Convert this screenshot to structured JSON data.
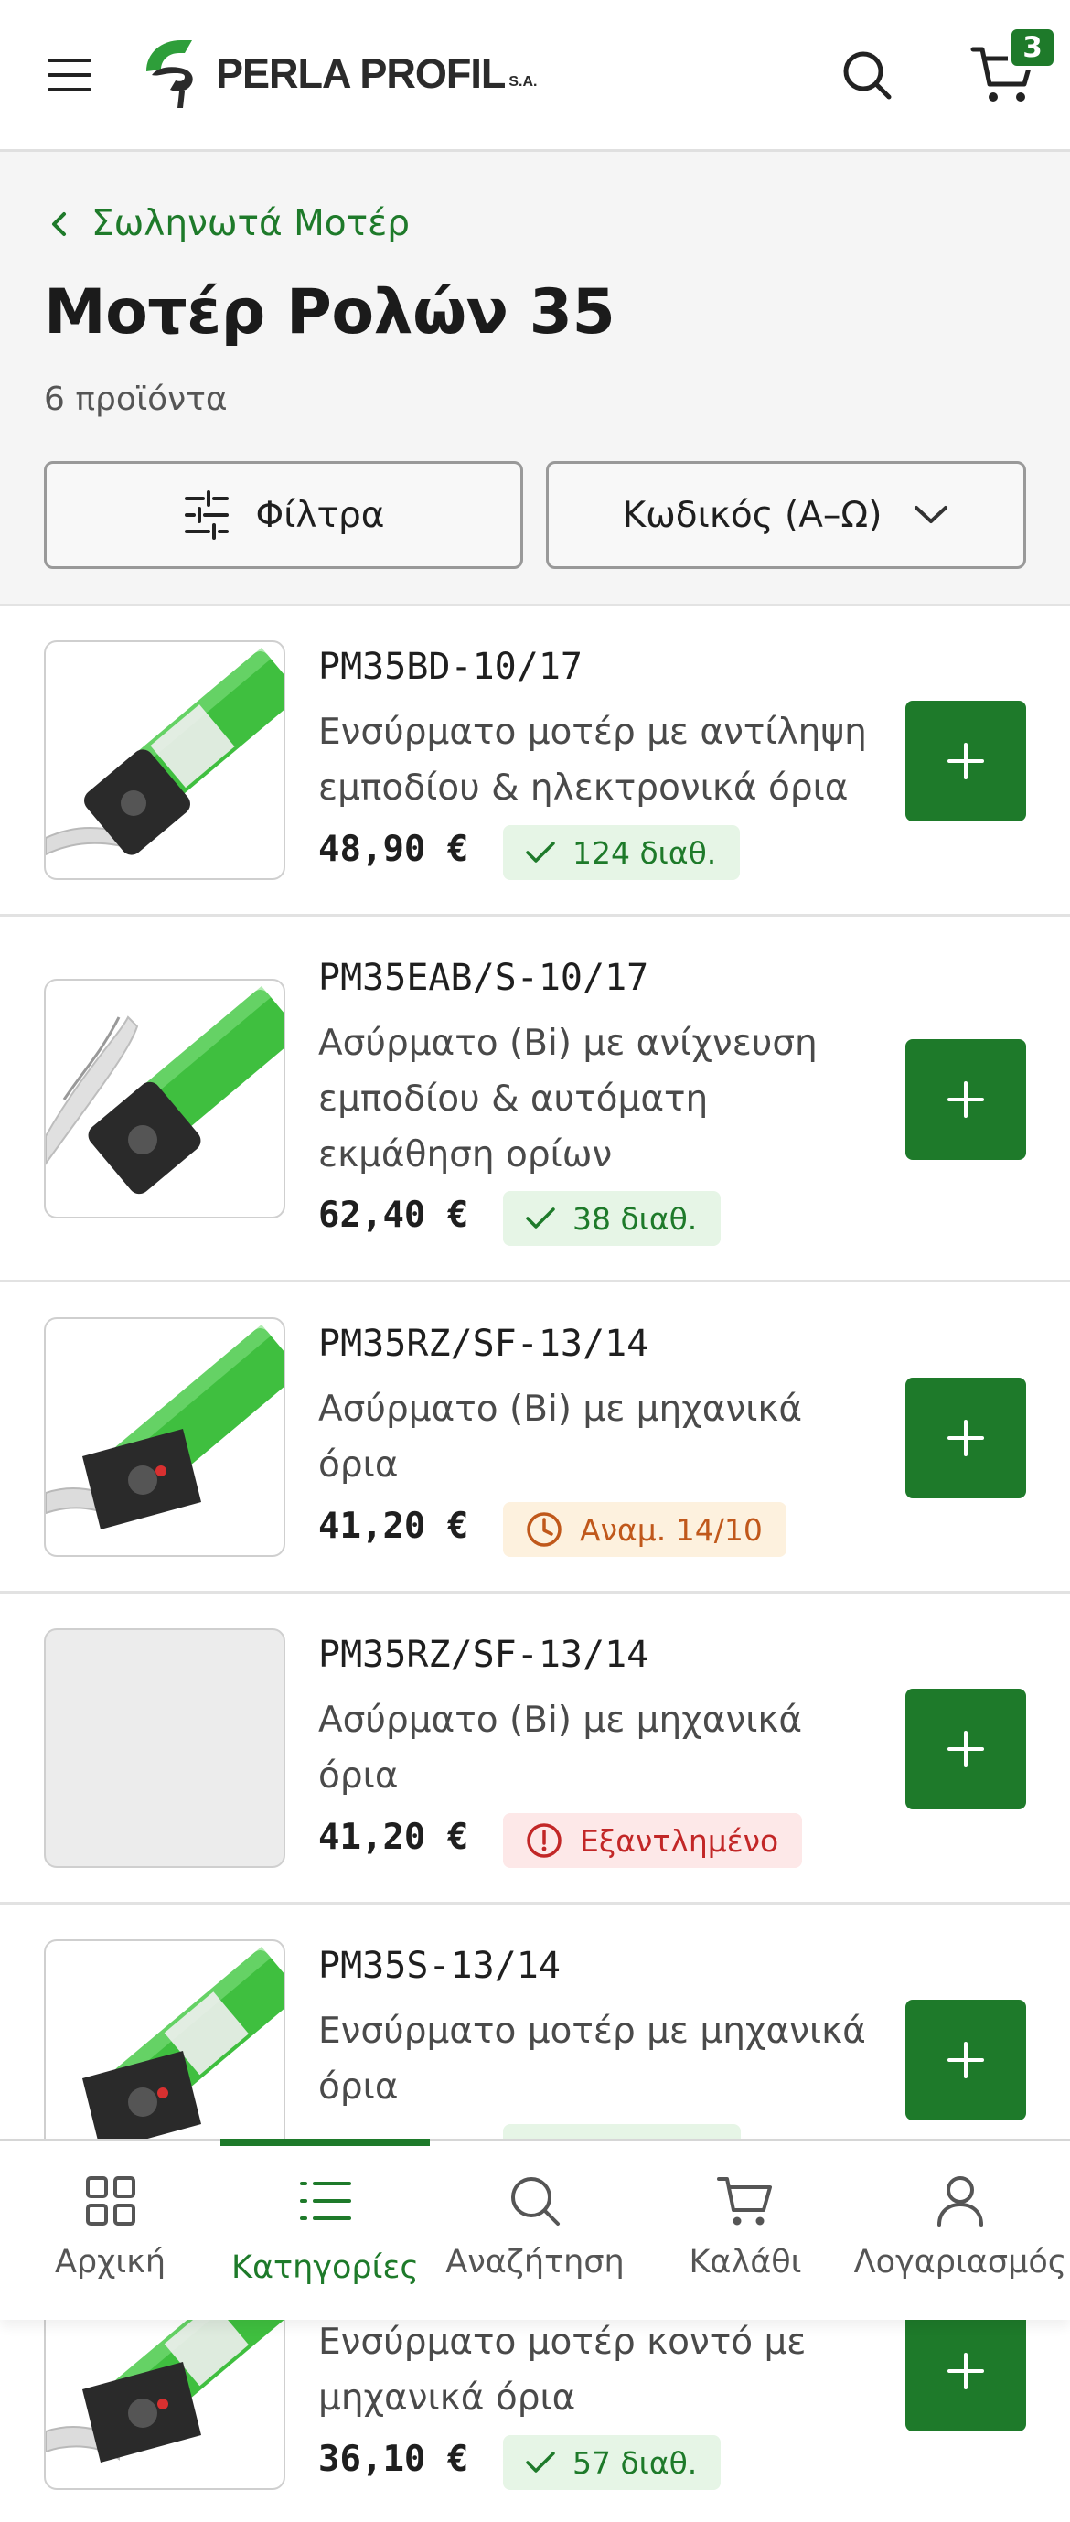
{
  "header": {
    "logo_text": "PERLA PROFIL",
    "logo_suffix": "S.A.",
    "cart_count": "3"
  },
  "category": {
    "breadcrumb": "Σωληνωτά Μοτέρ",
    "title": "Μοτέρ Ρολών 35",
    "count": "6 προϊόντα",
    "filter_label": "Φίλτρα",
    "sort_label": "Κωδικός (Α–Ω)"
  },
  "products": [
    {
      "sku": "PM35BD-10/17",
      "desc": "Ενσύρματο μοτέρ με αντίληψη εμποδίου & ηλεκτρονικά όρια",
      "price": "48,90 €",
      "stock": "124 διαθ.",
      "stock_status": "available"
    },
    {
      "sku": "PM35EAB/S-10/17",
      "desc": "Ασύρματο (Bi) με ανίχνευση εμποδίου & αυτόματη εκμάθηση ορίων",
      "price": "62,40 €",
      "stock": "38 διαθ.",
      "stock_status": "available"
    },
    {
      "sku": "PM35RZ/SF-13/14",
      "desc": "Ασύρματο (Bi) με μηχανικά όρια",
      "price": "41,20 €",
      "stock": "Αναμ. 14/10",
      "stock_status": "expected"
    },
    {
      "sku": "PM35RZ/SF-13/14",
      "desc": "Ασύρματο (Bi) με μηχανικά όρια",
      "price": "41,20 €",
      "stock": "Εξαντλημένο",
      "stock_status": "out"
    },
    {
      "sku": "PM35S-13/14",
      "desc": "Ενσύρματο μοτέρ με μηχανικά όρια",
      "price": "",
      "stock": "",
      "stock_status": "available"
    },
    {
      "sku": "",
      "desc": "Ενσύρματο μοτέρ κοντό με μηχανικά όρια",
      "price": "36,10 €",
      "stock": "57 διαθ.",
      "stock_status": "available"
    }
  ],
  "bottom_nav": [
    {
      "label": "Αρχική",
      "icon": "grid-icon"
    },
    {
      "label": "Κατηγορίες",
      "icon": "list-icon",
      "active": true
    },
    {
      "label": "Αναζήτηση",
      "icon": "search-icon"
    },
    {
      "label": "Καλάθι",
      "icon": "cart-icon"
    },
    {
      "label": "Λογαριασμός",
      "icon": "user-icon"
    }
  ],
  "colors": {
    "brand_green": "#1e7a2a",
    "stock_ok_bg": "#e6f5e6",
    "stock_wait_bg": "#fdf1de",
    "stock_out_bg": "#fde8e8"
  }
}
